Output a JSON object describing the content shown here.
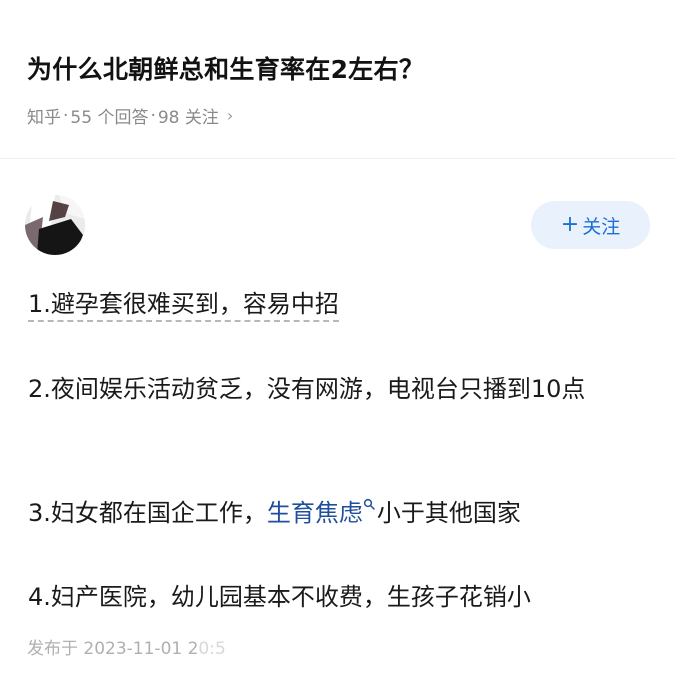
{
  "question": {
    "title": "为什么北朝鲜总和生育率在2左右？",
    "source": "知乎",
    "sep1": "·",
    "answers_count": "55 个回答",
    "sep2": "·",
    "followers_count": "98 关注",
    "chevron": "›"
  },
  "author": {
    "follow_plus": "+",
    "follow_label": "关注"
  },
  "answer": {
    "p1": "1.避孕套很难买到，容易中招",
    "p2": "2.夜间娱乐活动贫乏，没有网游，电视台只播到10点",
    "p3_before": "3.妇女都在国企工作，",
    "p3_keyword": "生育焦虑",
    "p3_after": "小于其他国家",
    "p4": "4.妇产医院，幼儿园基本不收费，生孩子花销小",
    "published_prefix": "发布于 2023-11-01 2",
    "published_faded": "0:5"
  },
  "colors": {
    "accent": "#1d6fd6",
    "follow_bg": "#e8f1fc",
    "keyword": "#1f4f9c",
    "muted": "#8a8a8a"
  },
  "icons": {
    "chevron": "chevron-right-icon",
    "keyword_search": "search-icon"
  }
}
